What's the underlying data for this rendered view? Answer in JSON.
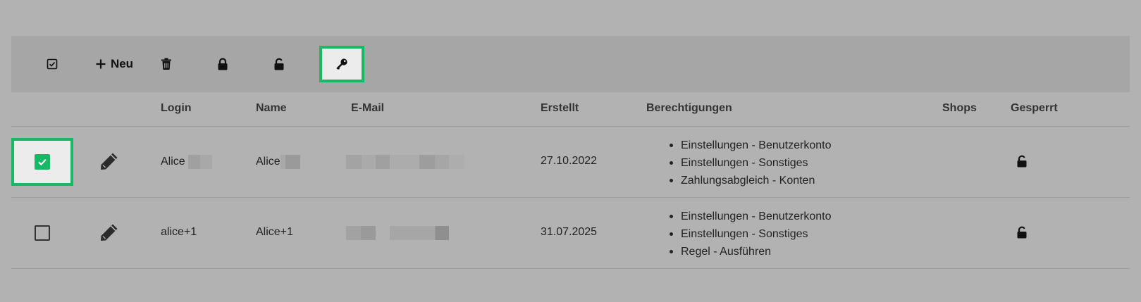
{
  "toolbar": {
    "select_all_icon": "checkbox-icon",
    "new_label": "Neu",
    "delete_icon": "trash-icon",
    "lock_icon": "lock-icon",
    "unlock_icon": "unlock-icon",
    "key_icon": "key-icon",
    "accent": "#19b865"
  },
  "columns": {
    "login": "Login",
    "name": "Name",
    "email": "E-Mail",
    "created": "Erstellt",
    "permissions": "Berechtigungen",
    "shops": "Shops",
    "locked": "Gesperrt"
  },
  "rows": [
    {
      "selected": true,
      "login": "Alice",
      "name": "Alice",
      "created": "27.10.2022",
      "permissions": [
        "Einstellungen - Benutzerkonto",
        "Einstellungen - Sonstiges",
        "Zahlungsabgleich - Konten"
      ],
      "locked_icon": "unlock-icon"
    },
    {
      "selected": false,
      "login": "alice+1",
      "name": "Alice+1",
      "created": "31.07.2025",
      "permissions": [
        "Einstellungen - Benutzerkonto",
        "Einstellungen - Sonstiges",
        "Regel - Ausführen"
      ],
      "locked_icon": "unlock-icon"
    }
  ]
}
